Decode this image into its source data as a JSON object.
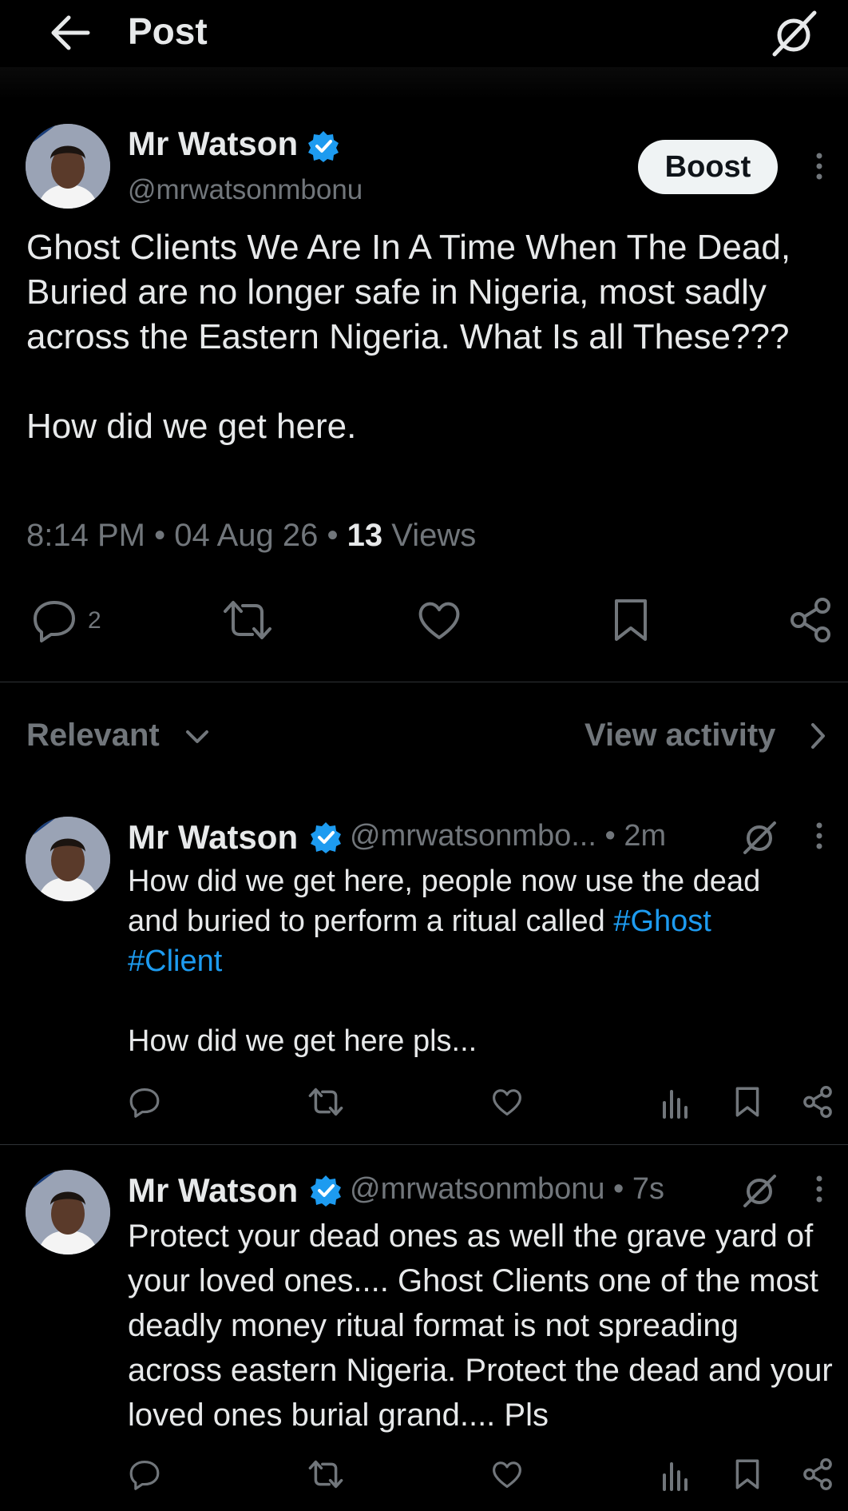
{
  "header": {
    "title": "Post",
    "back_icon": "arrow-left-icon",
    "grok_icon": "grok-slash-icon"
  },
  "post": {
    "author": {
      "name": "Mr Watson",
      "handle": "@mrwatsonmbonu",
      "verified": true
    },
    "boost_label": "Boost",
    "text_paragraphs": [
      "Ghost Clients We Are In A Time When The Dead, Buried are no longer safe in Nigeria, most sadly across the Eastern Nigeria. What Is all These???",
      "How did we get here."
    ],
    "time": "8:14 PM",
    "date": "04 Aug 26",
    "views_count": "13",
    "views_label": "Views",
    "reply_count": "2"
  },
  "sort": {
    "label": "Relevant",
    "view_activity": "View activity"
  },
  "replies": [
    {
      "name": "Mr Watson",
      "handle": "@mrwatsonmbo...",
      "time": "• 2m",
      "text_line1_a": "How did we get here, people now use the dead",
      "text_line2_a": "and buried to perform a ritual called ",
      "hashtag1": "#Ghost",
      "hashtag2": "#Client",
      "text_para2": "How did we get here pls..."
    },
    {
      "name": "Mr Watson",
      "handle": "@mrwatsonmbonu",
      "time": "• 7s",
      "text": "Protect your dead ones as well the grave yard of your loved ones.... Ghost Clients one of the most deadly money ritual format is not spreading across eastern Nigeria. Protect the dead and your loved ones burial grand.... Pls"
    }
  ],
  "colors": {
    "background": "#000000",
    "text": "#e7e9ea",
    "secondary": "#71767b",
    "link": "#1d9bf0",
    "verified": "#1d9bf0",
    "divider": "#2f3336"
  }
}
